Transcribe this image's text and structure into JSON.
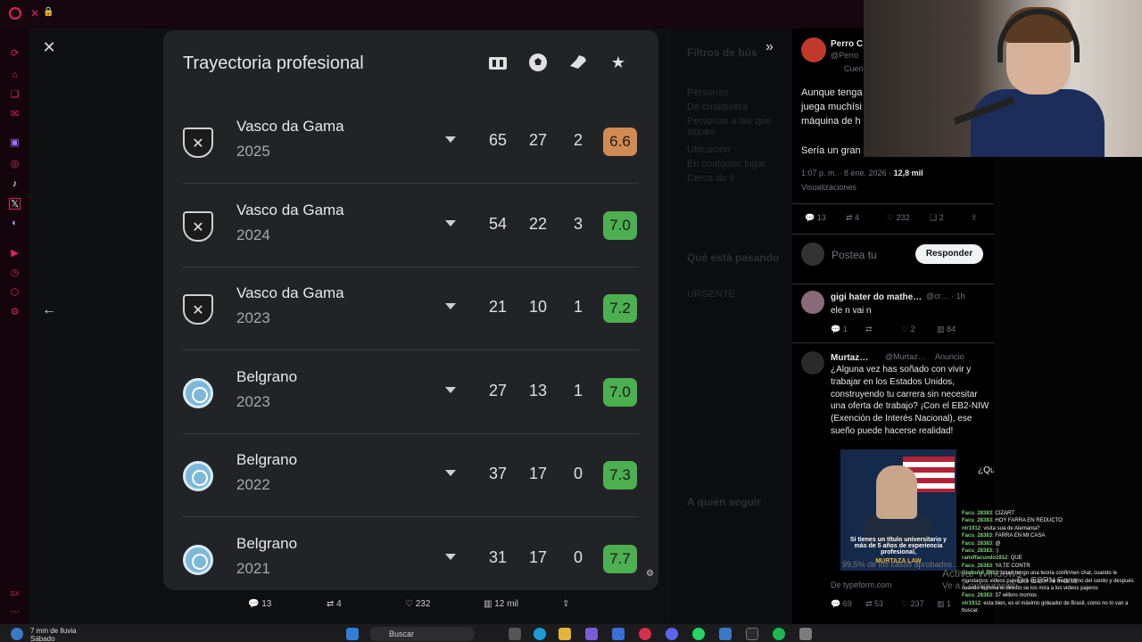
{
  "browser": {
    "tab_close": "✕",
    "lock": "🔒"
  },
  "modal": {
    "close": "✕",
    "back": "←",
    "expand": "»",
    "title": "Trayectoria profesional",
    "header_icons": [
      "shirt-icon",
      "ball-icon",
      "boot-icon",
      "star-icon"
    ],
    "rows": [
      {
        "team": "Vasco da Gama",
        "year": "2025",
        "apps": "65",
        "goals": "27",
        "assists": "2",
        "rating": "6.6",
        "rating_color": "#d08b52",
        "crest": "vasco"
      },
      {
        "team": "Vasco da Gama",
        "year": "2024",
        "apps": "54",
        "goals": "22",
        "assists": "3",
        "rating": "7.0",
        "rating_color": "#4caf50",
        "crest": "vasco"
      },
      {
        "team": "Vasco da Gama",
        "year": "2023",
        "apps": "21",
        "goals": "10",
        "assists": "1",
        "rating": "7.2",
        "rating_color": "#4caf50",
        "crest": "vasco"
      },
      {
        "team": "Belgrano",
        "year": "2023",
        "apps": "27",
        "goals": "13",
        "assists": "1",
        "rating": "7.0",
        "rating_color": "#4caf50",
        "crest": "belg"
      },
      {
        "team": "Belgrano",
        "year": "2022",
        "apps": "37",
        "goals": "17",
        "assists": "0",
        "rating": "7.3",
        "rating_color": "#4caf50",
        "crest": "belg"
      },
      {
        "team": "Belgrano",
        "year": "2021",
        "apps": "31",
        "goals": "17",
        "assists": "0",
        "rating": "7.7",
        "rating_color": "#4caf50",
        "crest": "belg"
      }
    ],
    "bottom": {
      "replies": "13",
      "retweets": "4",
      "likes": "232",
      "views": "12 mil"
    }
  },
  "backdrop": {
    "filters": "Filtros de bús",
    "people": "Personas",
    "from_anyone": "De cualquiera",
    "you_follow": "Personas a las que sigues",
    "location": "Ubicación",
    "anywhere": "En cualquier lugar",
    "near_you": "Cerca de ti",
    "trending": "Qué está pasando",
    "urgent": "URGENTE",
    "who_follow": "A quién seguir"
  },
  "tweet": {
    "author": "Perro C",
    "handle": "@Perro",
    "sub": "Cuen",
    "text1": "Aunque tenga",
    "text2": "juega muchísi",
    "text3": "máquina de h",
    "text4": "Sería un gran",
    "time": "1:07 p. m. · 8 ene. 2026 ·",
    "views_count": "12,8 mil",
    "views_label": "Visualizaciones",
    "stats": {
      "replies": "13",
      "retweets": "4",
      "likes": "232",
      "bookmarks": "2"
    },
    "post_placeholder": "Postea tu",
    "reply_btn": "Responder"
  },
  "reply1": {
    "name": "gigi hater do mathe…",
    "handle": "@cr… · 1h",
    "text": "ele n vai n",
    "replies": "1",
    "likes": "2",
    "views": "84"
  },
  "ad": {
    "name": "Murtaz…",
    "handle": "@Murtaz…",
    "label": "Anuncio",
    "text": "¿Alguna vez has soñado con vivir y trabajar en los Estados Unidos, construyendo tu carrera sin necesitar una oferta de trabajo? ¡Con el EB2-NIW (Exención de Interés Nacional), ese sueño puede hacerse realidad!",
    "img_caption": "Si tienes un título universitario y más de 5 años de experiencia profesional,",
    "brand": "MURTAZA LAW",
    "caption": "99,5% de los casos aprobados…",
    "domain": "De typeform.com",
    "side": "¿Qu",
    "stats": {
      "replies": "69",
      "retweets": "53",
      "likes": "237",
      "views": "1"
    }
  },
  "chat": [
    {
      "u": "Facu_28383",
      "m": ": CIZART"
    },
    {
      "u": "Facu_28383",
      "m": ": HOY FARRA EN REDUCTO"
    },
    {
      "u": "nlr1912",
      "m": ": visita sua de Alemania?"
    },
    {
      "u": "Facu_28383",
      "m": ": FARRA EN MI CASA"
    },
    {
      "u": "Facu_28383",
      "m": ": @"
    },
    {
      "u": "Facu_28383",
      "m": ": :)"
    },
    {
      "u": "ramiffacundo1912",
      "m": ": QUE"
    },
    {
      "u": "Facu_28383",
      "m": ": YA TE CONTR"
    },
    {
      "u": "Giuliano_2913",
      "m": ": cizart tengo una teoría confirmen chat, cuando le mandamos videos pajeros a cizart el se hace como del sonito y después cuando termina el directo se los mira a los videos pajeros"
    },
    {
      "u": "Facu_28383",
      "m": ": 37 willoro momos"
    },
    {
      "u": "nlr1912",
      "m": ": esta bien, es el máximo goleador de Brasil, como no lo van a buscar."
    }
  ],
  "activate": {
    "line1": "Activar Windows",
    "line2": "Ve a Configuración",
    "espn": "De ESPN Fans"
  },
  "taskbar": {
    "weather1": "7 mm de lluvia",
    "weather2": "Sábado",
    "search": "Buscar"
  }
}
